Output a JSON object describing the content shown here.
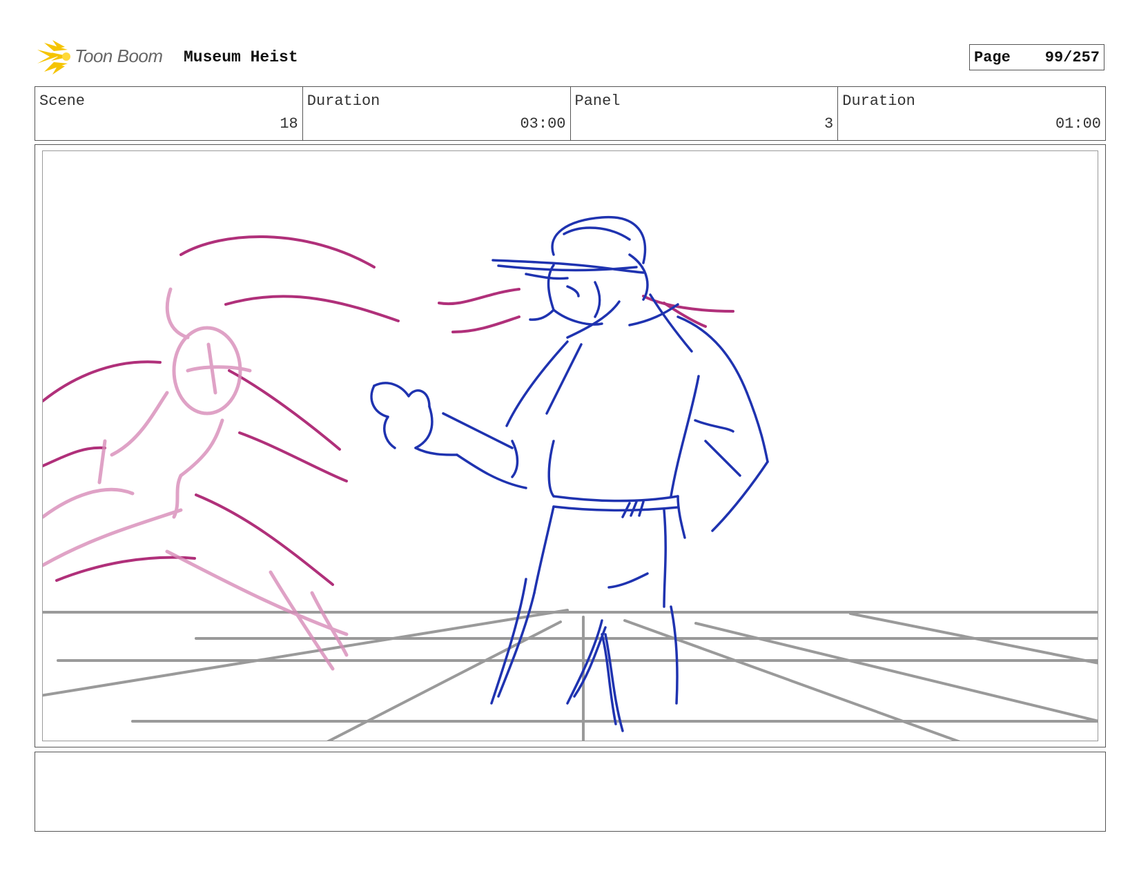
{
  "header": {
    "brand": "Toon Boom",
    "project_title": "Museum Heist",
    "page_label": "Page",
    "page_value": "99/257"
  },
  "info": {
    "scene_label": "Scene",
    "scene_value": "18",
    "scene_duration_label": "Duration",
    "scene_duration_value": "03:00",
    "panel_label": "Panel",
    "panel_value": "3",
    "panel_duration_label": "Duration",
    "panel_duration_value": "01:00"
  },
  "notes": {
    "text": ""
  },
  "colors": {
    "sketch_blue": "#1f33b0",
    "sketch_magenta": "#b0307a",
    "perspective_gray": "#9a9a9a",
    "logo_yellow": "#f5c400"
  }
}
